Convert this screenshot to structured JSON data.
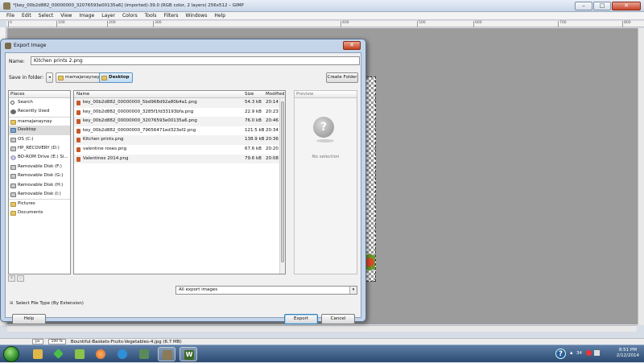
{
  "main_window": {
    "title": "*[key_00b2d882_00000000_32076593e00135a6] (imported)-39.0 (RGB color, 2 layers) 256x512 – GIMP",
    "controls": {
      "minimize": "–",
      "maximize": "□",
      "close": "✕"
    },
    "menu": [
      "File",
      "Edit",
      "Select",
      "View",
      "Image",
      "Layer",
      "Colors",
      "Tools",
      "Filters",
      "Windows",
      "Help"
    ],
    "ruler_ticks": [
      "0",
      "100",
      "200",
      "300",
      "400",
      "500",
      "600",
      "700",
      "800"
    ],
    "status": {
      "unit": "px",
      "zoom": "100 %",
      "file": "Bountiful-Baskets-Fruits-Vegetables-4.jpg (6.7 MB)"
    }
  },
  "dialog": {
    "title": "Export Image",
    "close": "✕",
    "name_label": "Name:",
    "name_value": "Kitchen prints 2.png",
    "folder_label": "Save in folder:",
    "crumb_arrow": "◂",
    "breadcrumbs": [
      "mamajanaynay",
      "Desktop"
    ],
    "create_folder": "Create Folder",
    "places_header": "Places",
    "places": [
      {
        "label": "Search",
        "icon": "search"
      },
      {
        "label": "Recently Used",
        "icon": "recent"
      },
      {
        "label": "mamajanaynay",
        "icon": "home"
      },
      {
        "label": "Desktop",
        "icon": "desktop"
      },
      {
        "label": "OS (C:)",
        "icon": "drive"
      },
      {
        "label": "HP_RECOVERY (D:)",
        "icon": "drive"
      },
      {
        "label": "BD-ROM Drive (E:) Si...",
        "icon": "disc"
      },
      {
        "label": "Removable Disk (F:)",
        "icon": "drive"
      },
      {
        "label": "Removable Disk (G:)",
        "icon": "drive"
      },
      {
        "label": "Removable Disk (H:)",
        "icon": "drive"
      },
      {
        "label": "Removable Disk (I:)",
        "icon": "drive"
      },
      {
        "label": "Pictures",
        "icon": "folder"
      },
      {
        "label": "Documents",
        "icon": "folder"
      }
    ],
    "places_buttons": {
      "add": "+",
      "remove": "–"
    },
    "columns": {
      "name": "Name",
      "size": "Size",
      "modified": "Modified"
    },
    "files": [
      {
        "name": "key_00b2d882_00000000_5bd968d92a80b4a1.png",
        "size": "54.3 kB",
        "modified": "20:14"
      },
      {
        "name": "key_00b2d882_00000000_3285f1fd33193bfa.png",
        "size": "22.9 kB",
        "modified": "20:23"
      },
      {
        "name": "key_00b2d882_00000000_32076593e00135a6.png",
        "size": "76.0 kB",
        "modified": "20:46"
      },
      {
        "name": "key_00b2d882_00000000_79656471ed323ef2.png",
        "size": "121.5 kB",
        "modified": "20:34"
      },
      {
        "name": "Kitchen prints.png",
        "size": "138.9 kB",
        "modified": "20:36"
      },
      {
        "name": "valentine roses.png",
        "size": "67.6 kB",
        "modified": "20:20"
      },
      {
        "name": "Valentines 2014.png",
        "size": "79.6 kB",
        "modified": "20:08"
      }
    ],
    "preview_header": "Preview",
    "preview_glyph": "?",
    "no_selection": "No selection",
    "filter_value": "All export images",
    "filter_arrow": "▾",
    "filetype_toggle": "Select File Type (By Extension)",
    "filetype_plus": "⊞",
    "help_label": "Help",
    "export_label": "Export",
    "cancel_label": "Cancel"
  },
  "taskbar": {
    "items": [
      {
        "name": "explorer",
        "color": "#e0b84a"
      },
      {
        "name": "sims",
        "color": "#4bbf4b"
      },
      {
        "name": "notepad-green",
        "color": "#8bc34a"
      },
      {
        "name": "firefox",
        "color": "#e66a1f"
      },
      {
        "name": "ie",
        "color": "#2f8fd8"
      },
      {
        "name": "network",
        "color": "#5a8a5a"
      },
      {
        "name": "gimp",
        "color": "#8a7a56"
      },
      {
        "name": "word-w",
        "color": "#3a6a2a"
      }
    ],
    "tray_help": "?",
    "tray_arrow": "▴",
    "tray_count": "34",
    "clock_time": "8:51 PM",
    "clock_date": "2/12/2014"
  }
}
